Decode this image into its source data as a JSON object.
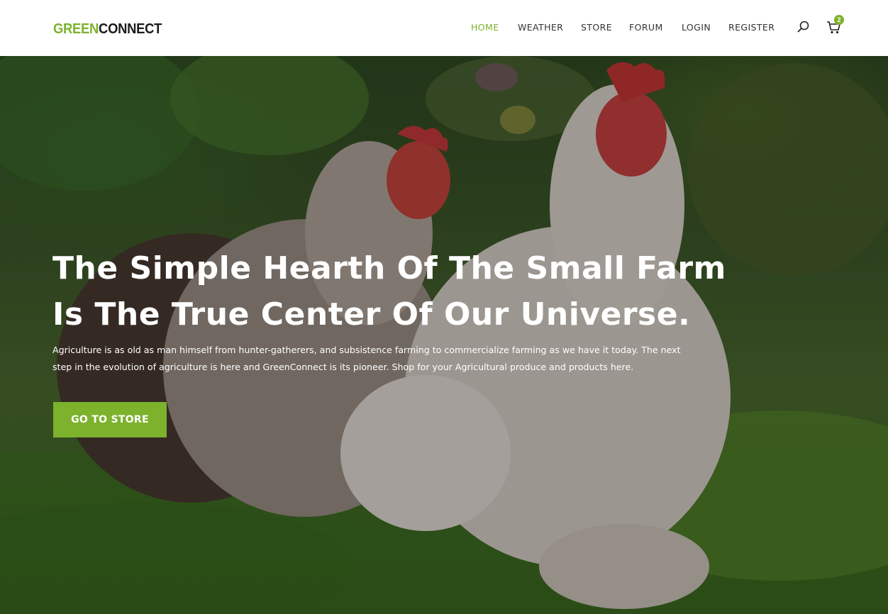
{
  "header": {
    "logo_green": "GREEN",
    "logo_dark": "CONNECT",
    "nav": [
      {
        "label": "HOME",
        "active": true
      },
      {
        "label": "WEATHER",
        "active": false
      },
      {
        "label": "STORE",
        "active": false
      },
      {
        "label": "FORUM",
        "active": false
      },
      {
        "label": "LOGIN",
        "active": false
      },
      {
        "label": "REGISTER",
        "active": false
      }
    ],
    "search_icon": "search-icon",
    "cart_icon": "cart-icon",
    "cart_count": "2"
  },
  "hero": {
    "headline_line1": "The Simple Hearth Of The Small Farm",
    "headline_line2": "Is The True Center Of Our Universe.",
    "body": "Agriculture is as old as man himself from hunter-gatherers, and subsistence farming to commercialize farming as we have it today. The next step in the evolution of agriculture is here and GreenConnect is its pioneer. Shop for your Agricultural produce and products here.",
    "cta_label": "GO TO STORE"
  },
  "colors": {
    "brand_green": "#7cb22c",
    "nav_text": "#333333",
    "hero_text": "#ffffff"
  }
}
